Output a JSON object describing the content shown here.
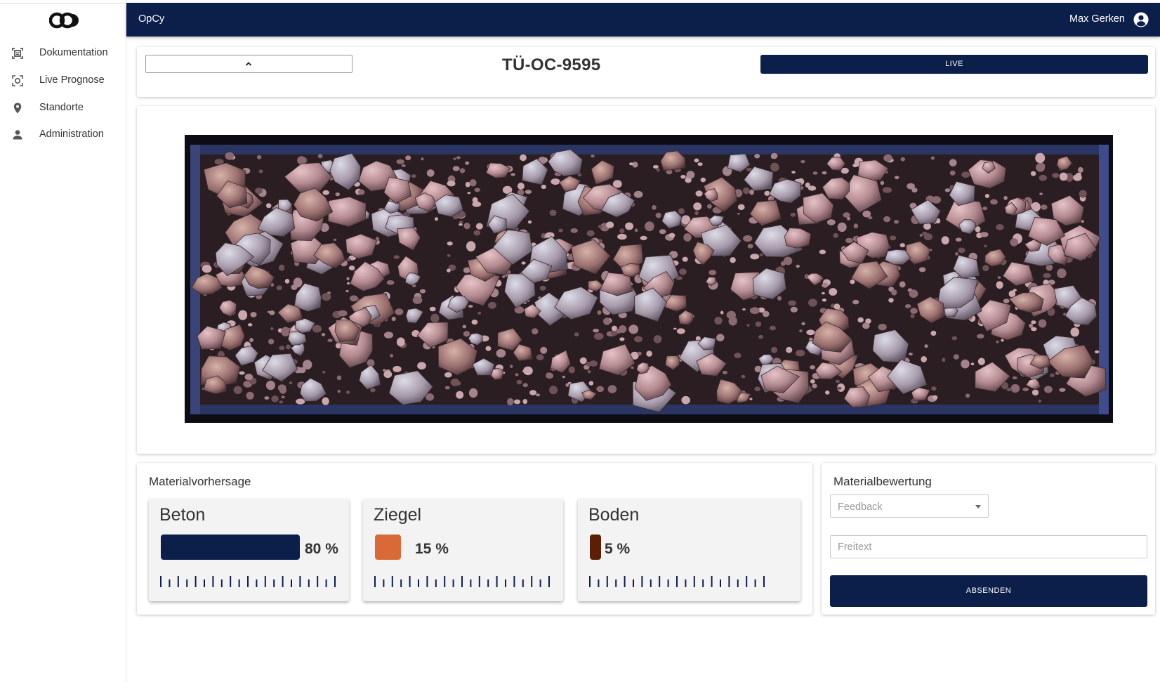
{
  "app": {
    "title": "OpCy"
  },
  "user": {
    "name": "Max Gerken"
  },
  "sidebar": {
    "items": [
      {
        "label": "Dokumentation",
        "icon": "document-scan-icon"
      },
      {
        "label": "Live Prognose",
        "icon": "camera-scan-icon"
      },
      {
        "label": "Standorte",
        "icon": "map-pin-icon"
      },
      {
        "label": "Administration",
        "icon": "person-icon"
      }
    ]
  },
  "header_card": {
    "device_id": "TÜ-OC-9595",
    "live_label": "LIVE"
  },
  "prediction": {
    "title": "Materialvorhersage",
    "materials": [
      {
        "name": "Beton",
        "value": 80,
        "pct_label": "80 %",
        "color": "#0c1f4b"
      },
      {
        "name": "Ziegel",
        "value": 15,
        "pct_label": "15 %",
        "color": "#d96a38"
      },
      {
        "name": "Boden",
        "value": 5,
        "pct_label": "5 %",
        "color": "#5a1f05"
      }
    ]
  },
  "rating": {
    "title": "Materialbewertung",
    "feedback_placeholder": "Feedback",
    "freitext_placeholder": "Freitext",
    "submit_label": "ABSENDEN"
  },
  "colors": {
    "primary": "#0c1f4b",
    "background": "#ffffff"
  }
}
